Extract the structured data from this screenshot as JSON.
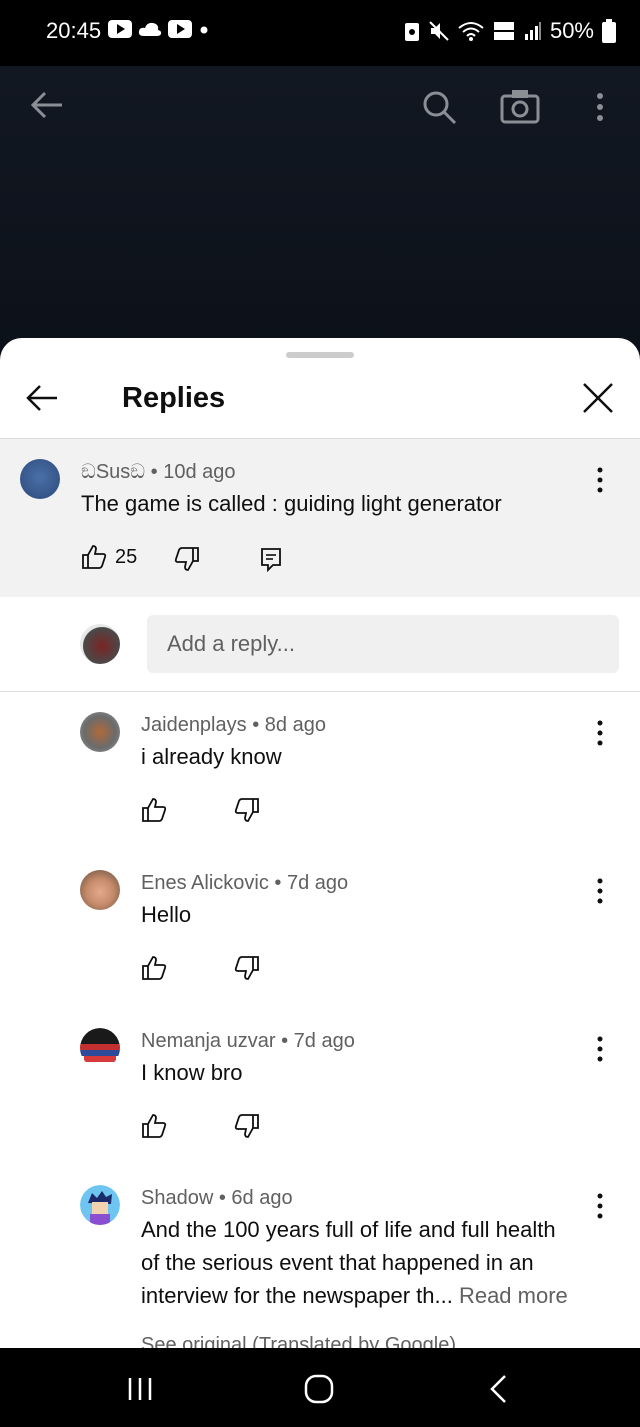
{
  "status_bar": {
    "time": "20:45",
    "battery": "50%"
  },
  "sheet": {
    "title": "Replies"
  },
  "parent_comment": {
    "author": "ඞSusඞ",
    "age": "10d ago",
    "text": "The game is called : guiding light generator",
    "likes": "25"
  },
  "reply_box": {
    "placeholder": "Add a reply..."
  },
  "replies": [
    {
      "author": "Jaidenplays",
      "age": "8d ago",
      "text": "i already know"
    },
    {
      "author": "Enes Alickovic",
      "age": "7d ago",
      "text": "Hello"
    },
    {
      "author": "Nemanja uzvar",
      "age": "7d ago",
      "text": "I know bro"
    },
    {
      "author": "Shadow",
      "age": "6d ago",
      "text_lines": [
        "And the 100 years full of life and full health",
        "of the serious event that happened in an",
        "interview for the newspaper th..."
      ],
      "read_more": "Read more",
      "see_original": "See original (Translated by Google)"
    }
  ],
  "separator": "•",
  "colors": {
    "accent_text": "#0f0f0f",
    "secondary_text": "#606060",
    "parent_bg": "#f2f2f2"
  }
}
